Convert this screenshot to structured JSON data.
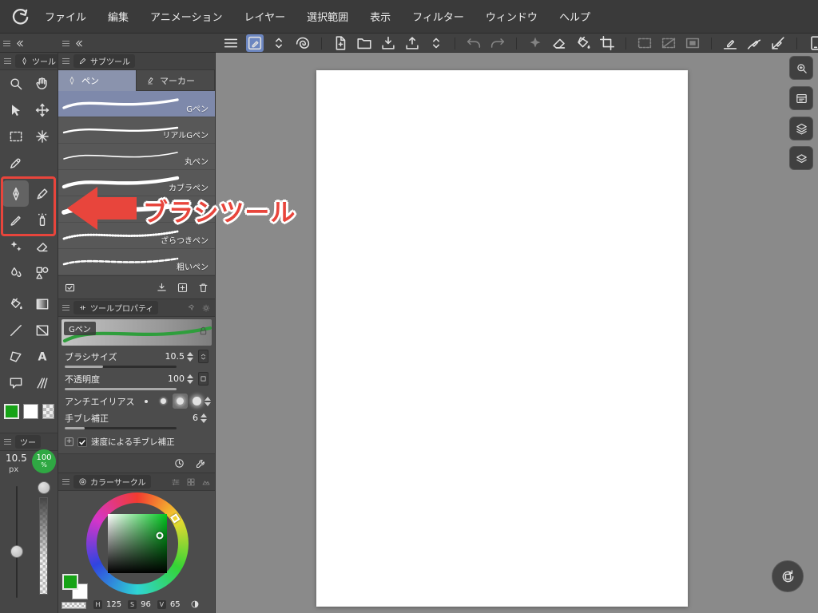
{
  "colors": {
    "annotation_red": "#e8453c",
    "subtool_selected_blue": "#8a93ad",
    "toolbar_selected_blue": "#6c86c0",
    "main_color_green": "#17a317",
    "opacity_badge_green": "#2fa843"
  },
  "menubar": {
    "items": [
      "ファイル",
      "編集",
      "アニメーション",
      "レイヤー",
      "選択範囲",
      "表示",
      "フィルター",
      "ウィンドウ",
      "ヘルプ"
    ]
  },
  "tool_palette": {
    "title": "ツール"
  },
  "subtool_panel": {
    "title": "サブツール",
    "tabs": [
      {
        "label": "ペン"
      },
      {
        "label": "マーカー"
      }
    ],
    "items": [
      {
        "label": "Gペン"
      },
      {
        "label": "リアルGペン"
      },
      {
        "label": "丸ペン"
      },
      {
        "label": "カブラペン"
      },
      {
        "label": ""
      },
      {
        "label": "ざらつきペン"
      },
      {
        "label": "粗いペン"
      }
    ]
  },
  "tool_property": {
    "title": "ツールプロパティ",
    "tool_name": "Gペン",
    "brush_size": {
      "label": "ブラシサイズ",
      "value": "10.5"
    },
    "opacity": {
      "label": "不透明度",
      "value": "100"
    },
    "antialias": {
      "label": "アンチエイリアス"
    },
    "stabilize": {
      "label": "手ブレ補正",
      "value": "6"
    },
    "speed_stabilize": {
      "label": "速度による手ブレ補正"
    }
  },
  "color_panel": {
    "title": "カラーサークル",
    "h": {
      "label": "H",
      "value": "125"
    },
    "s": {
      "label": "S",
      "value": "96"
    },
    "v": {
      "label": "V",
      "value": "65"
    }
  },
  "size_strip": {
    "title": "ツー",
    "size": "10.5",
    "size_unit": "px",
    "opacity": "100",
    "opacity_unit": "%"
  },
  "annotation": {
    "label": "ブラシツール"
  }
}
